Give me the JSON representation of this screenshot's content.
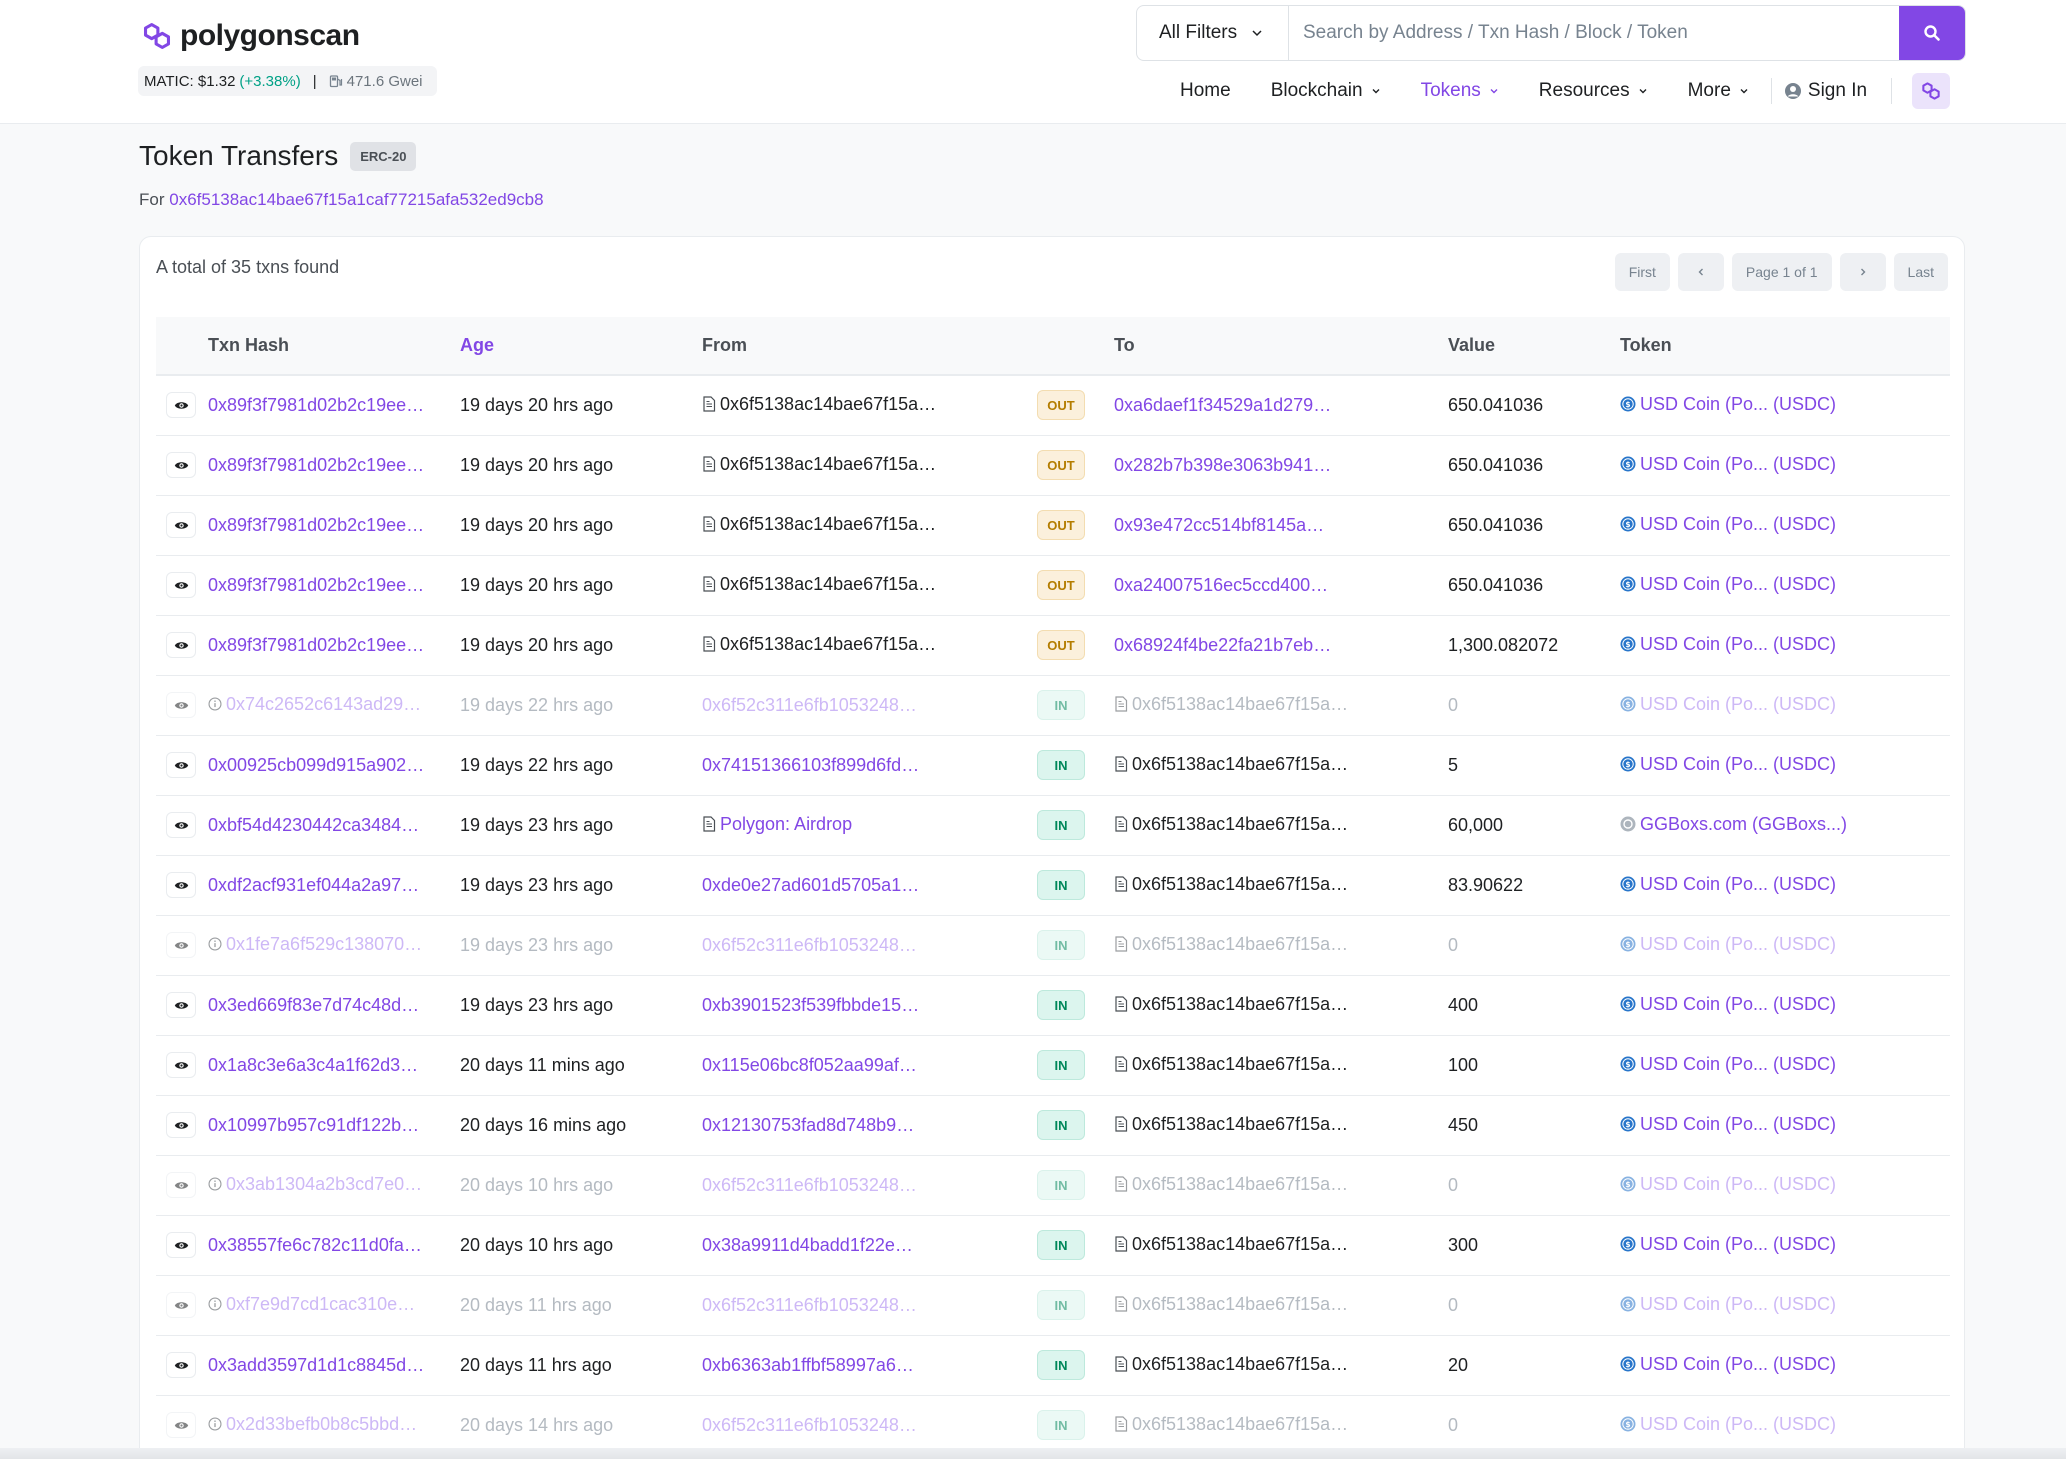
{
  "header": {
    "logo_text": "polygonscan",
    "price_label": "MATIC: $1.32",
    "price_change": "(+3.38%)",
    "separator": "|",
    "gas": "471.6 Gwei",
    "filter_label": "All Filters",
    "search_placeholder": "Search by Address / Txn Hash / Block / Token",
    "nav": {
      "home": "Home",
      "blockchain": "Blockchain",
      "tokens": "Tokens",
      "resources": "Resources",
      "more": "More",
      "sign_in": "Sign In"
    }
  },
  "page": {
    "title": "Token Transfers",
    "badge": "ERC-20",
    "for_label": "For",
    "address": "0x6f5138ac14bae67f15a1caf77215afa532ed9cb8"
  },
  "summary": "A total of 35 txns found",
  "pager": {
    "first": "First",
    "page_label": "Page 1 of 1",
    "last": "Last"
  },
  "columns": {
    "txn_hash": "Txn Hash",
    "age": "Age",
    "from": "From",
    "to": "To",
    "value": "Value",
    "token": "Token"
  },
  "rows": [
    {
      "hash": "0x89f3f7981d02b2c19ee…",
      "age": "19 days 20 hrs ago",
      "from": "0x6f5138ac14bae67f15a…",
      "dir": "OUT",
      "to": "0xa6daef1f34529a1d279…",
      "value": "650.041036",
      "token": "USD Coin (Po... (USDC)"
    },
    {
      "hash": "0x89f3f7981d02b2c19ee…",
      "age": "19 days 20 hrs ago",
      "from": "0x6f5138ac14bae67f15a…",
      "dir": "OUT",
      "to": "0x282b7b398e3063b941…",
      "value": "650.041036",
      "token": "USD Coin (Po... (USDC)"
    },
    {
      "hash": "0x89f3f7981d02b2c19ee…",
      "age": "19 days 20 hrs ago",
      "from": "0x6f5138ac14bae67f15a…",
      "dir": "OUT",
      "to": "0x93e472cc514bf8145a…",
      "value": "650.041036",
      "token": "USD Coin (Po... (USDC)"
    },
    {
      "hash": "0x89f3f7981d02b2c19ee…",
      "age": "19 days 20 hrs ago",
      "from": "0x6f5138ac14bae67f15a…",
      "dir": "OUT",
      "to": "0xa24007516ec5ccd400…",
      "value": "650.041036",
      "token": "USD Coin (Po... (USDC)"
    },
    {
      "hash": "0x89f3f7981d02b2c19ee…",
      "age": "19 days 20 hrs ago",
      "from": "0x6f5138ac14bae67f15a…",
      "dir": "OUT",
      "to": "0x68924f4be22fa21b7eb…",
      "value": "1,300.082072",
      "token": "USD Coin (Po... (USDC)"
    },
    {
      "hash": "0x74c2652c6143ad29…",
      "age": "19 days 22 hrs ago",
      "from": "0x6f52c311e6fb1053248…",
      "dir": "IN",
      "to": "0x6f5138ac14bae67f15a…",
      "value": "0",
      "token": "USD Coin (Po... (USDC)",
      "faded": true
    },
    {
      "hash": "0x00925cb099d915a902…",
      "age": "19 days 22 hrs ago",
      "from": "0x74151366103f899d6fd…",
      "dir": "IN",
      "to": "0x6f5138ac14bae67f15a…",
      "value": "5",
      "token": "USD Coin (Po... (USDC)"
    },
    {
      "hash": "0xbf54d4230442ca3484…",
      "age": "19 days 23 hrs ago",
      "from": "Polygon: Airdrop",
      "dir": "IN",
      "to": "0x6f5138ac14bae67f15a…",
      "value": "60,000",
      "token": "GGBoxs.com (GGBoxs...)",
      "from_contract": true,
      "gray_token": true
    },
    {
      "hash": "0xdf2acf931ef044a2a97…",
      "age": "19 days 23 hrs ago",
      "from": "0xde0e27ad601d5705a1…",
      "dir": "IN",
      "to": "0x6f5138ac14bae67f15a…",
      "value": "83.90622",
      "token": "USD Coin (Po... (USDC)"
    },
    {
      "hash": "0x1fe7a6f529c138070…",
      "age": "19 days 23 hrs ago",
      "from": "0x6f52c311e6fb1053248…",
      "dir": "IN",
      "to": "0x6f5138ac14bae67f15a…",
      "value": "0",
      "token": "USD Coin (Po... (USDC)",
      "faded": true
    },
    {
      "hash": "0x3ed669f83e7d74c48d…",
      "age": "19 days 23 hrs ago",
      "from": "0xb3901523f539fbbde15…",
      "dir": "IN",
      "to": "0x6f5138ac14bae67f15a…",
      "value": "400",
      "token": "USD Coin (Po... (USDC)"
    },
    {
      "hash": "0x1a8c3e6a3c4a1f62d3…",
      "age": "20 days 11 mins ago",
      "from": "0x115e06bc8f052aa99af…",
      "dir": "IN",
      "to": "0x6f5138ac14bae67f15a…",
      "value": "100",
      "token": "USD Coin (Po... (USDC)"
    },
    {
      "hash": "0x10997b957c91df122b…",
      "age": "20 days 16 mins ago",
      "from": "0x12130753fad8d748b9…",
      "dir": "IN",
      "to": "0x6f5138ac14bae67f15a…",
      "value": "450",
      "token": "USD Coin (Po... (USDC)"
    },
    {
      "hash": "0x3ab1304a2b3cd7e0…",
      "age": "20 days 10 hrs ago",
      "from": "0x6f52c311e6fb1053248…",
      "dir": "IN",
      "to": "0x6f5138ac14bae67f15a…",
      "value": "0",
      "token": "USD Coin (Po... (USDC)",
      "faded": true
    },
    {
      "hash": "0x38557fe6c782c11d0fa…",
      "age": "20 days 10 hrs ago",
      "from": "0x38a9911d4badd1f22e…",
      "dir": "IN",
      "to": "0x6f5138ac14bae67f15a…",
      "value": "300",
      "token": "USD Coin (Po... (USDC)"
    },
    {
      "hash": "0xf7e9d7cd1cac310e…",
      "age": "20 days 11 hrs ago",
      "from": "0x6f52c311e6fb1053248…",
      "dir": "IN",
      "to": "0x6f5138ac14bae67f15a…",
      "value": "0",
      "token": "USD Coin (Po... (USDC)",
      "faded": true
    },
    {
      "hash": "0x3add3597d1d1c8845d…",
      "age": "20 days 11 hrs ago",
      "from": "0xb6363ab1ffbf58997a6…",
      "dir": "IN",
      "to": "0x6f5138ac14bae67f15a…",
      "value": "20",
      "token": "USD Coin (Po... (USDC)"
    },
    {
      "hash": "0x2d33befb0b8c5bbd…",
      "age": "20 days 14 hrs ago",
      "from": "0x6f52c311e6fb1053248…",
      "dir": "IN",
      "to": "0x6f5138ac14bae67f15a…",
      "value": "0",
      "token": "USD Coin (Po... (USDC)",
      "faded": true
    }
  ]
}
